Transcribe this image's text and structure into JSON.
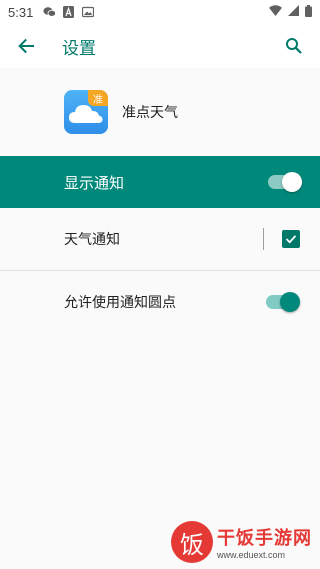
{
  "status_bar": {
    "time": "5:31",
    "left_icons": [
      "wechat-icon",
      "font-a-icon",
      "gallery-icon"
    ],
    "right_icons": [
      "wifi-icon",
      "signal-icon",
      "battery-icon"
    ]
  },
  "app_bar": {
    "title": "设置",
    "back_icon": "arrow-back-icon",
    "search_icon": "search-icon"
  },
  "app_header": {
    "name": "准点天气",
    "logo_badge": "准"
  },
  "master_toggle": {
    "label": "显示通知",
    "on": true
  },
  "settings": [
    {
      "label": "天气通知",
      "control": "checkbox",
      "checked": true
    },
    {
      "label": "允许使用通知圆点",
      "control": "switch",
      "on": true
    }
  ],
  "watermark": {
    "logo_text": "饭",
    "name": "干饭手游网",
    "url": "www.eduext.com"
  },
  "colors": {
    "accent": "#00796b",
    "master_bg": "#00897b",
    "background": "#fafafa"
  }
}
